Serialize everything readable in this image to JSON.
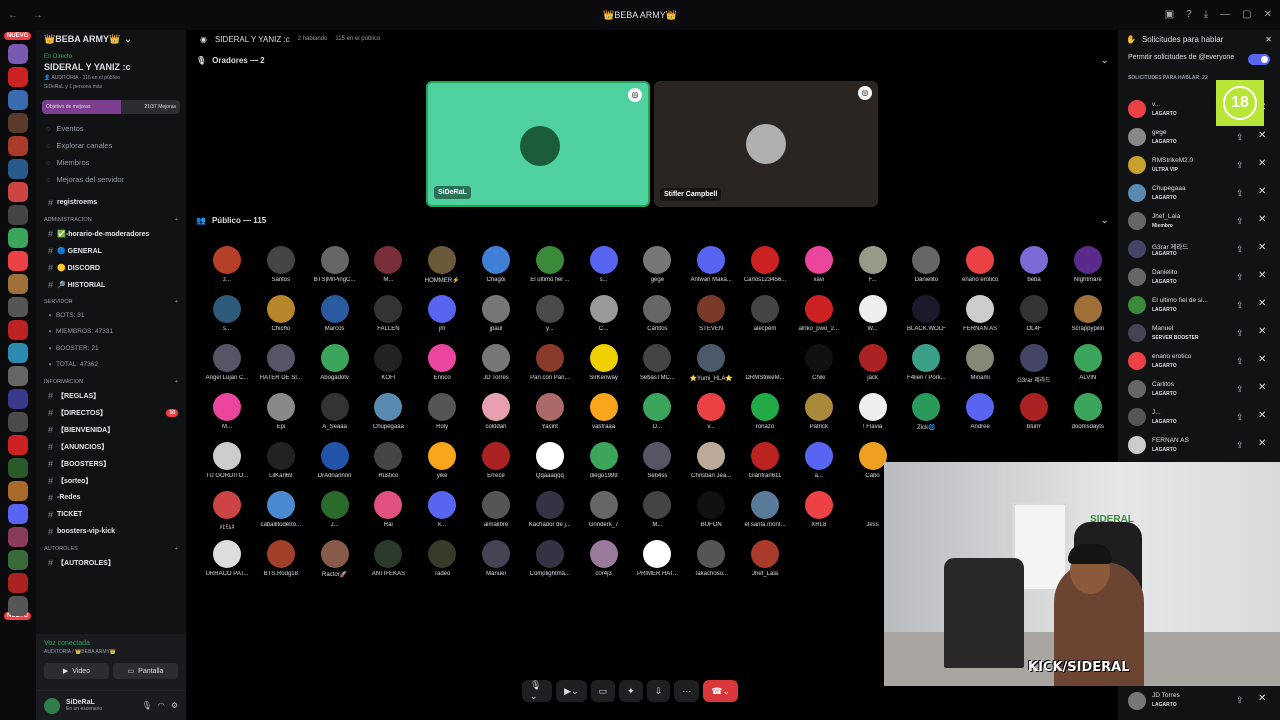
{
  "titlebar": {
    "title": "👑BEBA ARMY👑"
  },
  "server": {
    "name": "👑BEBA ARMY👑"
  },
  "live": {
    "status": "En Directo",
    "title": "SIDERAL Y YANIZ :c",
    "line1": "👤 AUDITORIA · 116 en el público",
    "line2": "SiDeRaL y 1 persona más"
  },
  "goal": {
    "label": "Objetivo de mejoras",
    "value": "21/37 Mejoras",
    "progress": 0.57
  },
  "nav": [
    {
      "label": "Eventos",
      "icon": "calendar-icon"
    },
    {
      "label": "Explorar canales",
      "icon": "compass-icon"
    },
    {
      "label": "Miembros",
      "icon": "members-icon"
    },
    {
      "label": "Mejoras del servidor",
      "icon": "boost-icon"
    }
  ],
  "channels_top": [
    {
      "label": "registroems"
    }
  ],
  "cat_admin": "ADMINISTRACION",
  "channels_admin": [
    {
      "label": "✅-horario-de-moderadores"
    },
    {
      "label": "🔵 GENERAL"
    },
    {
      "label": "🟡 DISCORD"
    },
    {
      "label": "🔎 HISTORIAL"
    }
  ],
  "cat_servidor": "SERVIDOR",
  "stats": [
    {
      "label": "BOTS: 31"
    },
    {
      "label": "MIEMBROS: 47331"
    },
    {
      "label": "BOOSTER: 21"
    },
    {
      "label": "TOTAL: 47362"
    }
  ],
  "cat_info": "INFORMACION",
  "channels_info": [
    {
      "label": "【REGLAS】",
      "badge": ""
    },
    {
      "label": "【DIRECTOS】",
      "badge": "10"
    },
    {
      "label": "【BIENVENIDA】",
      "badge": ""
    },
    {
      "label": "【ANUNCIOS】",
      "badge": ""
    },
    {
      "label": "【BOOSTERS】",
      "badge": ""
    },
    {
      "label": "【sorteo】",
      "badge": ""
    },
    {
      "label": "-Redes",
      "badge": ""
    },
    {
      "label": "TICKET",
      "badge": ""
    },
    {
      "label": "boosters-vip-kick",
      "badge": ""
    }
  ],
  "cat_autoroles": "AUTOROLES",
  "channels_auto": [
    {
      "label": "【AUTOROLES】"
    }
  ],
  "voice": {
    "status": "Voz conectada",
    "where": "AUDITORIA / 👑BEBA ARMY👑",
    "video": "Video",
    "screen": "Pantalla"
  },
  "user": {
    "name": "SiDeRaL",
    "status": "En un escenario"
  },
  "header": {
    "title": "SIDERAL Y YANIZ :c",
    "talking": "2 hablando",
    "audience": "115 en el público"
  },
  "speakers": {
    "label": "Oradores — 2",
    "tiles": [
      {
        "name": "SiDeRaL",
        "bg": "#4fd1a0",
        "av": "#1b5c3a"
      },
      {
        "name": "Stifler Campbell",
        "bg": "#2a2520",
        "av": "#b0b0b0"
      }
    ]
  },
  "audience_label": "Público — 115",
  "audience": [
    "z...",
    "Santos",
    "BTS|MrPingC...",
    "M...",
    "HOMMER⚡",
    "Chagoi",
    "El ultimo fiel ...",
    "s...",
    "gege",
    "Antwan Maka...",
    "Carlos123456...",
    "xavi",
    "F...",
    "Danielito",
    "enano erotico",
    "beba",
    "NIghtmare",
    "s...",
    "Chicho",
    "Marcos",
    "FALLEN",
    "jm",
    "jpaul",
    "y...",
    "C...",
    "Carlitos",
    "STEVEN",
    "alecpem",
    "alnko_pwo_2...",
    "W...",
    "BLACK.WOLF",
    "FERNAN AS",
    "OL4F",
    "Scrappypilin",
    "Angel Lujan C...",
    "HATER DE SI...",
    "Abogadotv",
    "KOFI",
    "Enrico",
    "JD Torres",
    "Pan con Pan...",
    "SirKenway",
    "SebasTMC...",
    "⭐Yumi_HLA⭐",
    "ΩRMStrikeM...",
    "Chiki",
    "jack",
    "F4lien / Pork...",
    "Minami",
    "G3rar 제라드",
    "ALVIN",
    "M...",
    "Epi",
    "A_Seaaa",
    "Chupegaaa",
    "Roly",
    "colddan",
    "Yacint",
    "vasfraaa",
    "D...",
    "v...",
    "ronazo",
    "Patrick",
    "! Flavia",
    "Zick🌀",
    "Andree",
    "blurrr",
    "doomsdayts",
    "TU GORDITO...",
    "LilKarl69",
    "DrAdriannnn",
    "Rustico",
    "yike",
    "Errece",
    "Qqaaaqqq",
    "diego1999",
    "Seb4ss",
    "Christian Jea...",
    "Gianfran611",
    "a...",
    "Cabo",
    "",
    "",
    "",
    "",
    "ﾒﾋﾓﾑﾈ",
    "caballitodetro...",
    "J...",
    "Rai",
    "k...",
    "almalibre",
    "Kachador de j...",
    "Grinderk_7",
    "M...",
    "BUFON",
    "el santa mont...",
    "XRL8",
    "Jess",
    "",
    "",
    "",
    "",
    "URRACO PAT...",
    "BTS.Rodg18",
    "Ractor🚀",
    "ANTIFEKAS",
    "Tadeo",
    "Manuel",
    "Complightma...",
    "c0r4j3",
    "PRIMER HAT...",
    "Takachoso...",
    "Jhef_Lala",
    "",
    "",
    "",
    "",
    "",
    ""
  ],
  "audience_colors": [
    "#b5402a",
    "#444",
    "#666",
    "#7a2e3a",
    "#6b5a3a",
    "#3f7fd6",
    "#3a8a3a",
    "#5865f2",
    "#777",
    "#5865f2",
    "#c22",
    "#eb459e",
    "#998",
    "#666",
    "#ed4245",
    "#7a6ad6",
    "#5a2a8a",
    "#2d5a7a",
    "#b8862a",
    "#2a5aa0",
    "#333",
    "#5865f2",
    "#777",
    "#4a4a4a",
    "#999",
    "#666",
    "#7a3a2a",
    "#444",
    "#c22",
    "#eee",
    "#1a1a2a",
    "#ccc",
    "#333",
    "#a0703a",
    "#556",
    "#556",
    "#3ba55c",
    "#222",
    "#eb459e",
    "#777",
    "#8a3a2a",
    "#f0d000",
    "#444",
    "#4a5a6a",
    "#000",
    "#111",
    "#a22",
    "#3aa08a",
    "#887",
    "#446",
    "#3ba55c",
    "#eb459e",
    "#888",
    "#333",
    "#5a8ab0",
    "#555",
    "#e8a0b0",
    "#aa6a6a",
    "#faa61a",
    "#3ba55c",
    "#ed4245",
    "#22aa44",
    "#aa8a3a",
    "#eee",
    "#2a9a5a",
    "#5865f2",
    "#a22",
    "#3ba55c",
    "#ccc",
    "#222",
    "#2255aa",
    "#444",
    "#faa61a",
    "#a22",
    "#ffffff",
    "#3ba55c",
    "#556",
    "#ba9",
    "#b22",
    "#5865f2",
    "#f0a020",
    "#000",
    "#000",
    "#000",
    "#000",
    "#c44",
    "#4a8ad0",
    "#2a6a2a",
    "#e05080",
    "#5865f2",
    "#555",
    "#334",
    "#666",
    "#444",
    "#111",
    "#5a7a9a",
    "#ed4245",
    "#000",
    "#000",
    "#000",
    "#000",
    "#000",
    "#ddd",
    "#a0402a",
    "#885a4a",
    "#2a3a2a",
    "#3a3a2a",
    "#445",
    "#334",
    "#9a7a9a",
    "#ffffff",
    "#555",
    "#aa3a2a",
    "#000",
    "#000",
    "#000",
    "#000",
    "#000",
    "#000"
  ],
  "panel": {
    "title": "Solicitudes para hablar",
    "allow": "Permitir solicitudes de @everyone",
    "header": "SOLICITUDES PARA HABLAR: 22",
    "requests": [
      {
        "name": "v...",
        "role": "LAGARTO",
        "c": "#ed4245"
      },
      {
        "name": "gege",
        "role": "LAGARTO",
        "c": "#888"
      },
      {
        "name": "RMStrikeM2.0",
        "role": "ULTRA VIP",
        "c": "#c8a02a"
      },
      {
        "name": "Chupegaaa",
        "role": "LAGARTO",
        "c": "#5a8ab0"
      },
      {
        "name": "Jhef_Lala",
        "role": "Miembro",
        "c": "#666"
      },
      {
        "name": "G3rar 제라드",
        "role": "LAGARTO",
        "c": "#446"
      },
      {
        "name": "Danielito",
        "role": "LAGARTO",
        "c": "#666"
      },
      {
        "name": "El ultimo fiel de si...",
        "role": "LAGARTO",
        "c": "#3a8a3a"
      },
      {
        "name": "Manuel",
        "role": "SERVER BOOSTER",
        "c": "#445"
      },
      {
        "name": "enano erotico",
        "role": "LAGARTO",
        "c": "#ed4245"
      },
      {
        "name": "Carlitos",
        "role": "LAGARTO",
        "c": "#666"
      },
      {
        "name": "J...",
        "role": "LAGARTO",
        "c": "#555"
      },
      {
        "name": "FERNAN AS",
        "role": "LAGARTO",
        "c": "#ccc"
      }
    ],
    "last": {
      "name": "JD Torres",
      "role": "LAGARTO"
    }
  },
  "age_badge": "18",
  "cam": {
    "logo": "SIDERAL",
    "kick": "KICK/SIDERAL"
  },
  "rail": {
    "new_badge": "NUEVO"
  }
}
